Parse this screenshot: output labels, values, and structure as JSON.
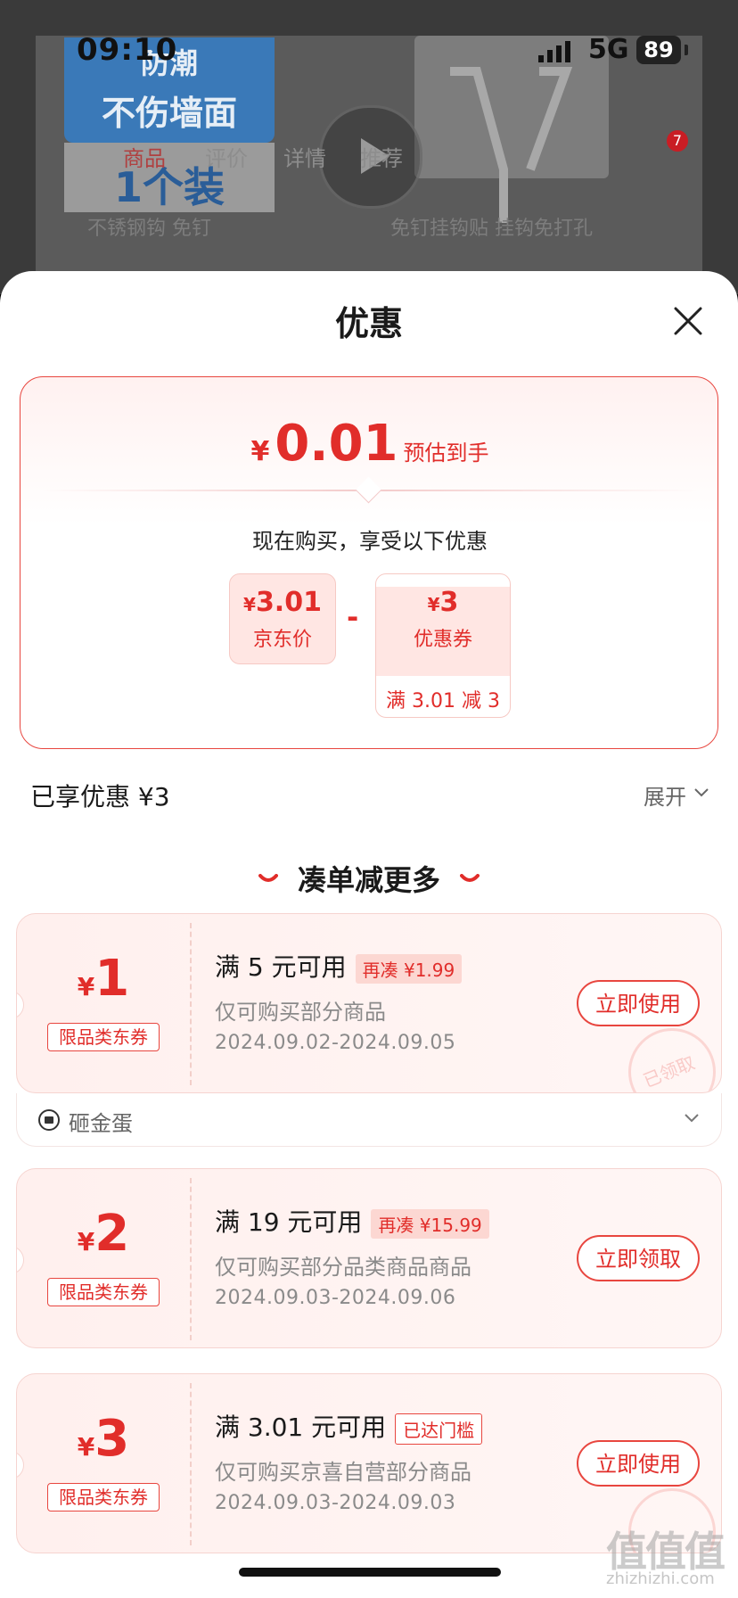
{
  "status_bar": {
    "time": "09:10",
    "network": "5G",
    "battery": "89"
  },
  "background": {
    "promo_line_1": "防潮",
    "promo_line_2": "不伤墙面",
    "promo_line_3": "1个装",
    "tabs": [
      "商品",
      "评价",
      "详情",
      "推荐"
    ],
    "search_text": "不锈钢钩 免钉",
    "search_suggest": "免钉挂钩贴  挂钩免打孔",
    "cart_badge": "7"
  },
  "sheet": {
    "title": "优惠",
    "estimate": {
      "yen": "¥",
      "price": "0.01",
      "note": "预估到手"
    },
    "subtitle": "现在购买，享受以下优惠",
    "jd_price": {
      "yen": "¥",
      "value": "3.01",
      "label": "京东价"
    },
    "operator": "-",
    "coupon_box": {
      "yen": "¥",
      "value": "3",
      "label": "优惠券",
      "condition": "满 3.01 减 3"
    },
    "enjoyed": "已享优惠 ¥3",
    "expand": "展开",
    "section_title": "凑单减更多"
  },
  "coupons": [
    {
      "yen": "¥",
      "amount": "1",
      "type": "限品类东券",
      "condition": "满 5 元可用",
      "tag": "再凑 ¥1.99",
      "scope": "仅可购买部分商品",
      "date": "2024.09.02-2024.09.05",
      "button": "立即使用",
      "stamp": "已领取"
    },
    {
      "yen": "¥",
      "amount": "2",
      "type": "限品类东券",
      "condition": "满 19 元可用",
      "tag": "再凑 ¥15.99",
      "scope": "仅可购买部分品类商品商品",
      "date": "2024.09.03-2024.09.06",
      "button": "立即领取"
    },
    {
      "yen": "¥",
      "amount": "3",
      "type": "限品类东券",
      "condition": "满 3.01 元可用",
      "tag": "已达门槛",
      "scope": "仅可购买京喜自营部分商品",
      "date": "2024.09.03-2024.09.03",
      "button": "立即使用"
    }
  ],
  "egg": {
    "label": "砸金蛋"
  },
  "watermark": {
    "main": "值值值",
    "sub": "zhizhizhi.com"
  },
  "colors": {
    "accent": "#e12d2a",
    "card_bg": "#fff0ee",
    "border": "#e8463f"
  }
}
